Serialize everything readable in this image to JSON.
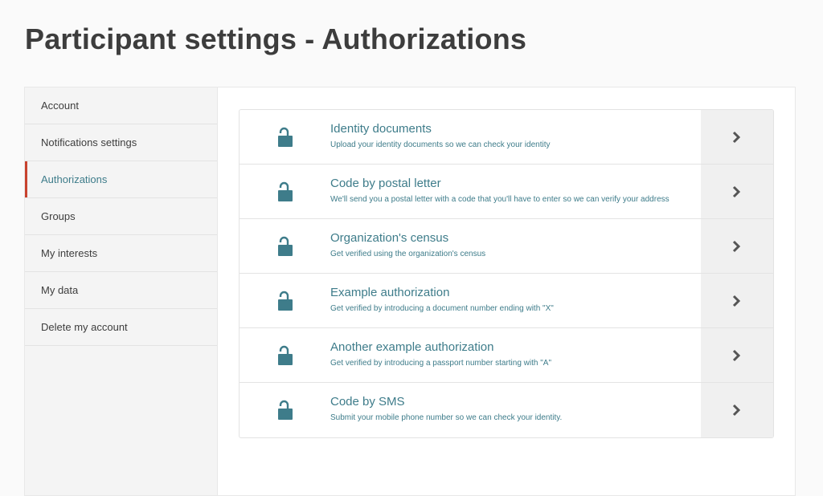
{
  "page": {
    "title": "Participant settings - Authorizations"
  },
  "sidebar": {
    "items": [
      {
        "label": "Account"
      },
      {
        "label": "Notifications settings"
      },
      {
        "label": "Authorizations"
      },
      {
        "label": "Groups"
      },
      {
        "label": "My interests"
      },
      {
        "label": "My data"
      },
      {
        "label": "Delete my account"
      }
    ],
    "active_index": 2
  },
  "authorizations": [
    {
      "title": "Identity documents",
      "description": "Upload your identity documents so we can check your identity"
    },
    {
      "title": "Code by postal letter",
      "description": "We'll send you a postal letter with a code that you'll have to enter so we can verify your address"
    },
    {
      "title": "Organization's census",
      "description": "Get verified using the organization's census"
    },
    {
      "title": "Example authorization",
      "description": "Get verified by introducing a document number ending with \"X\""
    },
    {
      "title": "Another example authorization",
      "description": "Get verified by introducing a passport number starting with \"A\""
    },
    {
      "title": "Code by SMS",
      "description": "Submit your mobile phone number so we can check your identity."
    }
  ],
  "icons": {
    "lock": "lock-open-icon",
    "arrow": "chevron-right-icon"
  },
  "colors": {
    "accent": "#3e7c8a",
    "active_marker": "#c8432f",
    "title": "#3d3d3d"
  }
}
